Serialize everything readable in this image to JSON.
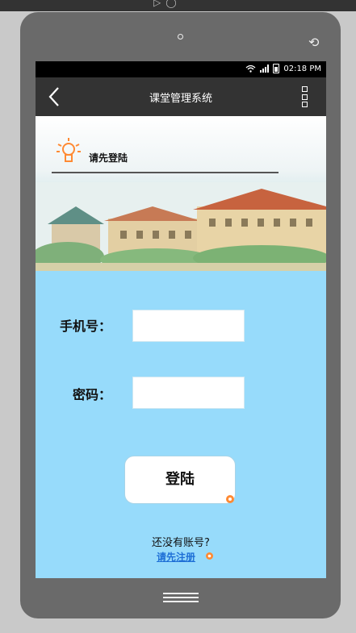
{
  "status_bar": {
    "time": "02:18 PM"
  },
  "header": {
    "title": "课堂管理系统"
  },
  "banner": {
    "prompt": "请先登陆"
  },
  "form": {
    "phone_label": "手机号：",
    "phone_value": "",
    "password_label": "密码：",
    "password_value": ""
  },
  "login": {
    "button_label": "登陆"
  },
  "footer": {
    "no_account": "还没有账号?",
    "register_link": "请先注册"
  },
  "colors": {
    "screen_bg": "#97dbfb",
    "titlebar": "#333333",
    "link": "#1e6fd6",
    "accent": "#ff8a33"
  }
}
